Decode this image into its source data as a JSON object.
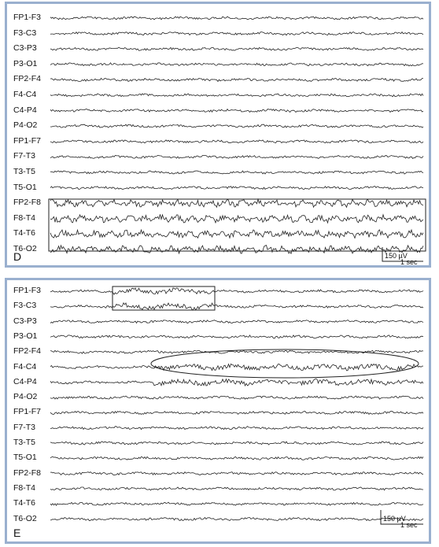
{
  "panels": [
    {
      "letter": "D",
      "channels": [
        "FP1-F3",
        "F3-C3",
        "C3-P3",
        "P3-O1",
        "FP2-F4",
        "F4-C4",
        "C4-P4",
        "P4-O2",
        "FP1-F7",
        "F7-T3",
        "T3-T5",
        "T5-O1",
        "FP2-F8",
        "F8-T4",
        "T4-T6",
        "T6-O2"
      ],
      "scale_amplitude": "150 µV",
      "scale_time": "1 sec"
    },
    {
      "letter": "E",
      "channels": [
        "FP1-F3",
        "F3-C3",
        "C3-P3",
        "P3-O1",
        "FP2-F4",
        "F4-C4",
        "C4-P4",
        "P4-O2",
        "FP1-F7",
        "F7-T3",
        "T3-T5",
        "T5-O1",
        "FP2-F8",
        "F8-T4",
        "T4-T6",
        "T6-O2"
      ],
      "scale_amplitude": "150 µV",
      "scale_time": "1 sec"
    }
  ]
}
